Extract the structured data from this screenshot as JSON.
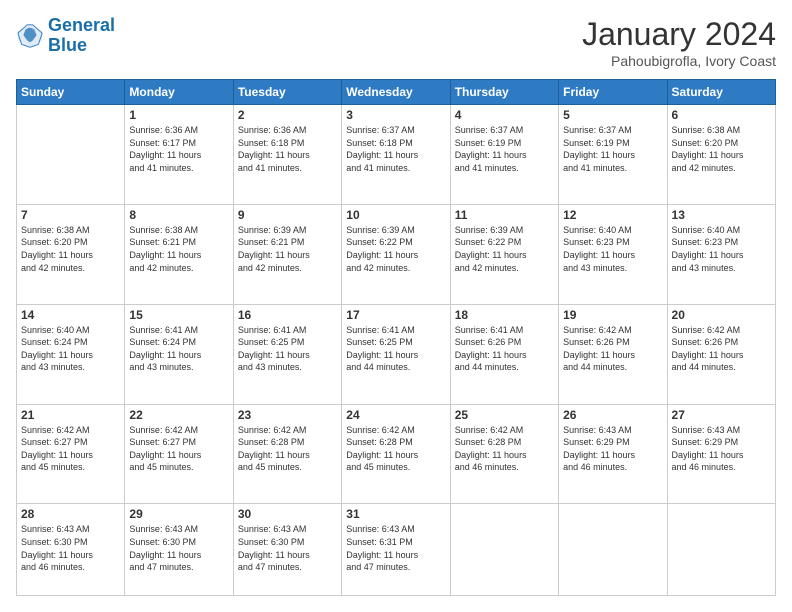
{
  "header": {
    "logo_line1": "General",
    "logo_line2": "Blue",
    "title": "January 2024",
    "subtitle": "Pahoubigrofla, Ivory Coast"
  },
  "days_of_week": [
    "Sunday",
    "Monday",
    "Tuesday",
    "Wednesday",
    "Thursday",
    "Friday",
    "Saturday"
  ],
  "weeks": [
    [
      {
        "day": "",
        "content": ""
      },
      {
        "day": "1",
        "content": "Sunrise: 6:36 AM\nSunset: 6:17 PM\nDaylight: 11 hours\nand 41 minutes."
      },
      {
        "day": "2",
        "content": "Sunrise: 6:36 AM\nSunset: 6:18 PM\nDaylight: 11 hours\nand 41 minutes."
      },
      {
        "day": "3",
        "content": "Sunrise: 6:37 AM\nSunset: 6:18 PM\nDaylight: 11 hours\nand 41 minutes."
      },
      {
        "day": "4",
        "content": "Sunrise: 6:37 AM\nSunset: 6:19 PM\nDaylight: 11 hours\nand 41 minutes."
      },
      {
        "day": "5",
        "content": "Sunrise: 6:37 AM\nSunset: 6:19 PM\nDaylight: 11 hours\nand 41 minutes."
      },
      {
        "day": "6",
        "content": "Sunrise: 6:38 AM\nSunset: 6:20 PM\nDaylight: 11 hours\nand 42 minutes."
      }
    ],
    [
      {
        "day": "7",
        "content": "Sunrise: 6:38 AM\nSunset: 6:20 PM\nDaylight: 11 hours\nand 42 minutes."
      },
      {
        "day": "8",
        "content": "Sunrise: 6:38 AM\nSunset: 6:21 PM\nDaylight: 11 hours\nand 42 minutes."
      },
      {
        "day": "9",
        "content": "Sunrise: 6:39 AM\nSunset: 6:21 PM\nDaylight: 11 hours\nand 42 minutes."
      },
      {
        "day": "10",
        "content": "Sunrise: 6:39 AM\nSunset: 6:22 PM\nDaylight: 11 hours\nand 42 minutes."
      },
      {
        "day": "11",
        "content": "Sunrise: 6:39 AM\nSunset: 6:22 PM\nDaylight: 11 hours\nand 42 minutes."
      },
      {
        "day": "12",
        "content": "Sunrise: 6:40 AM\nSunset: 6:23 PM\nDaylight: 11 hours\nand 43 minutes."
      },
      {
        "day": "13",
        "content": "Sunrise: 6:40 AM\nSunset: 6:23 PM\nDaylight: 11 hours\nand 43 minutes."
      }
    ],
    [
      {
        "day": "14",
        "content": "Sunrise: 6:40 AM\nSunset: 6:24 PM\nDaylight: 11 hours\nand 43 minutes."
      },
      {
        "day": "15",
        "content": "Sunrise: 6:41 AM\nSunset: 6:24 PM\nDaylight: 11 hours\nand 43 minutes."
      },
      {
        "day": "16",
        "content": "Sunrise: 6:41 AM\nSunset: 6:25 PM\nDaylight: 11 hours\nand 43 minutes."
      },
      {
        "day": "17",
        "content": "Sunrise: 6:41 AM\nSunset: 6:25 PM\nDaylight: 11 hours\nand 44 minutes."
      },
      {
        "day": "18",
        "content": "Sunrise: 6:41 AM\nSunset: 6:26 PM\nDaylight: 11 hours\nand 44 minutes."
      },
      {
        "day": "19",
        "content": "Sunrise: 6:42 AM\nSunset: 6:26 PM\nDaylight: 11 hours\nand 44 minutes."
      },
      {
        "day": "20",
        "content": "Sunrise: 6:42 AM\nSunset: 6:26 PM\nDaylight: 11 hours\nand 44 minutes."
      }
    ],
    [
      {
        "day": "21",
        "content": "Sunrise: 6:42 AM\nSunset: 6:27 PM\nDaylight: 11 hours\nand 45 minutes."
      },
      {
        "day": "22",
        "content": "Sunrise: 6:42 AM\nSunset: 6:27 PM\nDaylight: 11 hours\nand 45 minutes."
      },
      {
        "day": "23",
        "content": "Sunrise: 6:42 AM\nSunset: 6:28 PM\nDaylight: 11 hours\nand 45 minutes."
      },
      {
        "day": "24",
        "content": "Sunrise: 6:42 AM\nSunset: 6:28 PM\nDaylight: 11 hours\nand 45 minutes."
      },
      {
        "day": "25",
        "content": "Sunrise: 6:42 AM\nSunset: 6:28 PM\nDaylight: 11 hours\nand 46 minutes."
      },
      {
        "day": "26",
        "content": "Sunrise: 6:43 AM\nSunset: 6:29 PM\nDaylight: 11 hours\nand 46 minutes."
      },
      {
        "day": "27",
        "content": "Sunrise: 6:43 AM\nSunset: 6:29 PM\nDaylight: 11 hours\nand 46 minutes."
      }
    ],
    [
      {
        "day": "28",
        "content": "Sunrise: 6:43 AM\nSunset: 6:30 PM\nDaylight: 11 hours\nand 46 minutes."
      },
      {
        "day": "29",
        "content": "Sunrise: 6:43 AM\nSunset: 6:30 PM\nDaylight: 11 hours\nand 47 minutes."
      },
      {
        "day": "30",
        "content": "Sunrise: 6:43 AM\nSunset: 6:30 PM\nDaylight: 11 hours\nand 47 minutes."
      },
      {
        "day": "31",
        "content": "Sunrise: 6:43 AM\nSunset: 6:31 PM\nDaylight: 11 hours\nand 47 minutes."
      },
      {
        "day": "",
        "content": ""
      },
      {
        "day": "",
        "content": ""
      },
      {
        "day": "",
        "content": ""
      }
    ]
  ]
}
